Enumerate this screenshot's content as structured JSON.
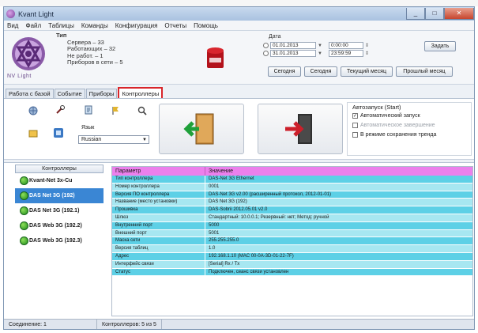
{
  "window": {
    "title": "Kvant Light"
  },
  "menu": [
    "Вид",
    "Файл",
    "Таблицы",
    "Команды",
    "Конфигурация",
    "Отчеты",
    "Помощь"
  ],
  "info": {
    "lines": [
      "Тип",
      "Сервера – 33",
      "Работающих – 32",
      "Не работ. – 1",
      "Приборов в сети – 5"
    ],
    "logo_text": "NV Light"
  },
  "date_panel": {
    "label": "Дата",
    "from_date": "01.01.2013",
    "from_time": "0:00:00",
    "to_date": "31.01.2013",
    "to_time": "23:59:59",
    "btn_set": "Задать",
    "btn_today": "Сегодня",
    "btn_prev": "Текущий месяц",
    "btn_next": "Прошлый месяц"
  },
  "tabs": [
    "Работа с базой",
    "Событие",
    "Приборы",
    "Контроллеры"
  ],
  "toolbar": {
    "lang_label": "Язык",
    "lang_value": "Russian",
    "auto_title": "Автозапуск (Start)",
    "auto_check1": "Автоматический запуск",
    "auto_check2": "Автоматическое завершение",
    "auto_check3": "В режиме сохранения тренда"
  },
  "list": {
    "header": "Контроллеры",
    "items": [
      "Kvant-Net 3x-Cu",
      "DAS Net 3G (192)",
      "DAS Net 3G (192.1)",
      "DAS Web 3G (192.2)",
      "DAS Web 3G (192.3)"
    ]
  },
  "props": {
    "col_name": "Параметр",
    "col_value": "Значение",
    "rows": [
      {
        "name": "Тип контроллера",
        "value": "DAS-Net 3G Ethernet"
      },
      {
        "name": "Номер контроллера",
        "value": "0001"
      },
      {
        "name": "Версия ПО контроллера",
        "value": "DAS-Net 3G v2.00 (расширенный протокол, 2012-01-01)"
      },
      {
        "name": "Название (место установки)",
        "value": "DAS Net 3G (192)"
      },
      {
        "name": "Прошивка",
        "value": "DAS-Sobrii 2012.05.01 v2.0"
      },
      {
        "name": "Шлюз",
        "value": "Стандартный: 10.0.0.1; Резервный: нет; Метод: ручной"
      },
      {
        "name": "Внутренний порт",
        "value": "5000"
      },
      {
        "name": "Внешний порт",
        "value": "5001"
      },
      {
        "name": "Маска сети",
        "value": "255.255.255.0"
      },
      {
        "name": "Версия таблиц",
        "value": "1.0"
      },
      {
        "name": "Адрес",
        "value": "192.168.1.10 (MAC 00-0A-3D-01-22-7F)"
      },
      {
        "name": "Интерфейс связи",
        "value": "[Serial] Rx / Tx"
      },
      {
        "name": "Статус",
        "value": "Подключен, сеанс связи установлен"
      }
    ]
  },
  "statusbar": {
    "left": "Соединение: 1",
    "right": "Контроллеров: 5 из 5"
  }
}
